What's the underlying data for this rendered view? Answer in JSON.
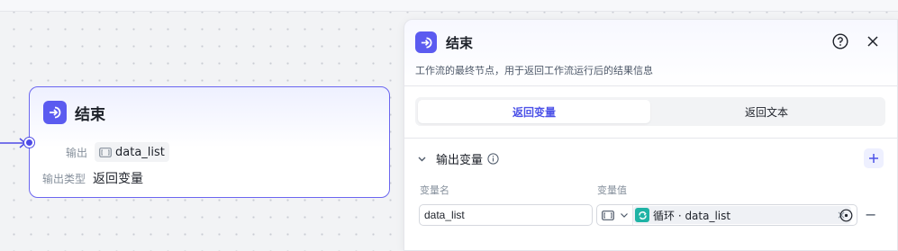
{
  "node": {
    "title": "结束",
    "output_label": "输出",
    "output_var": "data_list",
    "output_type_label": "输出类型",
    "output_type_value": "返回变量"
  },
  "panel": {
    "title": "结束",
    "description": "工作流的最终节点，用于返回工作流运行后的结果信息",
    "tabs": [
      {
        "label": "返回变量",
        "active": true
      },
      {
        "label": "返回文本",
        "active": false
      }
    ],
    "section_title": "输出变量",
    "columns": {
      "name": "变量名",
      "value": "变量值"
    },
    "row": {
      "name": "data_list",
      "ref_source": "循环",
      "ref_var": "data_list",
      "ref_text": "循环 · data_list"
    }
  },
  "colors": {
    "accent": "#5b5bf0",
    "loop_icon": "#1fb3a5",
    "active_tab_text": "#4d53e8"
  },
  "icons": {
    "node_icon": "end-node-icon",
    "help": "help-circle-icon",
    "close": "close-icon",
    "chevron": "chevron-down-icon",
    "info": "info-icon",
    "add": "plus-icon",
    "type": "array-type-icon",
    "loop": "loop-icon",
    "target": "target-icon",
    "remove": "minus-icon"
  }
}
